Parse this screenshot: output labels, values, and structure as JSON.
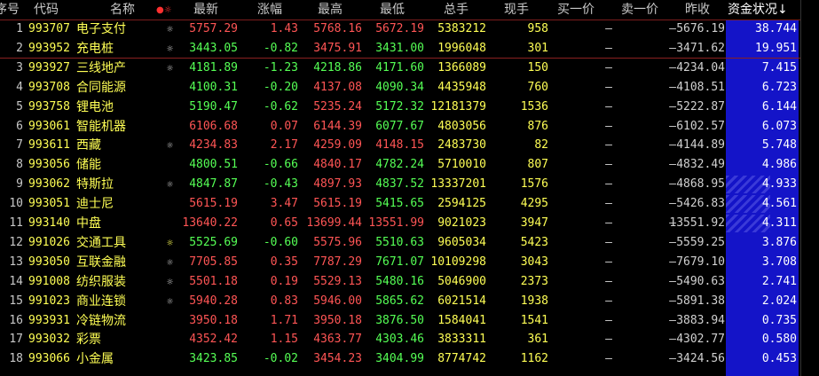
{
  "header": {
    "index": "序号",
    "code": "代码",
    "name": "名称",
    "flags": "●☼",
    "last": "最新",
    "change_pct": "涨幅",
    "high": "最高",
    "low": "最低",
    "total_vol": "总手",
    "cur_vol": "现手",
    "bid": "买一价",
    "ask": "卖一价",
    "prev_close": "昨收",
    "fund": "资金状况↓"
  },
  "colors": {
    "up": "#ff5555",
    "down": "#55ff55",
    "flat": "#d0d0d0",
    "code": "#ffff55",
    "sort_column": "#1414c8"
  },
  "rows": [
    {
      "i": "1",
      "code": "993707",
      "name": "电子支付",
      "gear": "gear-icon",
      "last": "5757.29",
      "chg": "1.43",
      "high": "5768.16",
      "low": "5672.19",
      "vol": "5383212",
      "cur": "958",
      "bid": "—",
      "ask": "—",
      "prev": "5676.19",
      "fund": "38.744",
      "dir": "up",
      "hcol": "red",
      "lcol": "red",
      "hatch": false
    },
    {
      "i": "2",
      "code": "993952",
      "name": "充电桩",
      "gear": "gear-icon",
      "last": "3443.05",
      "chg": "-0.82",
      "high": "3475.91",
      "low": "3431.00",
      "vol": "1996048",
      "cur": "301",
      "bid": "—",
      "ask": "—",
      "prev": "3471.62",
      "fund": "19.951",
      "dir": "down",
      "hcol": "red",
      "lcol": "green",
      "hatch": false
    },
    {
      "i": "3",
      "code": "993927",
      "name": "三线地产",
      "gear": "gear-icon",
      "last": "4181.89",
      "chg": "-1.23",
      "high": "4218.86",
      "low": "4171.60",
      "vol": "1366089",
      "cur": "150",
      "bid": "—",
      "ask": "—",
      "prev": "4234.04",
      "fund": "7.415",
      "dir": "down",
      "hcol": "green",
      "lcol": "green",
      "hatch": false
    },
    {
      "i": "4",
      "code": "993708",
      "name": "合同能源",
      "gear": "",
      "last": "4100.31",
      "chg": "-0.20",
      "high": "4137.08",
      "low": "4090.34",
      "vol": "4435948",
      "cur": "760",
      "bid": "—",
      "ask": "—",
      "prev": "4108.51",
      "fund": "6.723",
      "dir": "down",
      "hcol": "red",
      "lcol": "green",
      "hatch": false
    },
    {
      "i": "5",
      "code": "993758",
      "name": "锂电池",
      "gear": "",
      "last": "5190.47",
      "chg": "-0.62",
      "high": "5235.24",
      "low": "5172.32",
      "vol": "12181379",
      "cur": "1536",
      "bid": "—",
      "ask": "—",
      "prev": "5222.87",
      "fund": "6.144",
      "dir": "down",
      "hcol": "red",
      "lcol": "green",
      "hatch": false
    },
    {
      "i": "6",
      "code": "993061",
      "name": "智能机器",
      "gear": "",
      "last": "6106.68",
      "chg": "0.07",
      "high": "6144.39",
      "low": "6077.67",
      "vol": "4803056",
      "cur": "876",
      "bid": "—",
      "ask": "—",
      "prev": "6102.57",
      "fund": "6.073",
      "dir": "up",
      "hcol": "red",
      "lcol": "green",
      "hatch": false
    },
    {
      "i": "7",
      "code": "993611",
      "name": "西藏",
      "gear": "gear-icon",
      "last": "4234.83",
      "chg": "2.17",
      "high": "4259.09",
      "low": "4148.15",
      "vol": "2483730",
      "cur": "82",
      "bid": "—",
      "ask": "—",
      "prev": "4144.89",
      "fund": "5.748",
      "dir": "up",
      "hcol": "red",
      "lcol": "red",
      "hatch": false
    },
    {
      "i": "8",
      "code": "993056",
      "name": "储能",
      "gear": "",
      "last": "4800.51",
      "chg": "-0.66",
      "high": "4840.17",
      "low": "4782.24",
      "vol": "5710010",
      "cur": "807",
      "bid": "—",
      "ask": "—",
      "prev": "4832.49",
      "fund": "4.986",
      "dir": "down",
      "hcol": "red",
      "lcol": "green",
      "hatch": false
    },
    {
      "i": "9",
      "code": "993062",
      "name": "特斯拉",
      "gear": "gear-icon",
      "last": "4847.87",
      "chg": "-0.43",
      "high": "4897.93",
      "low": "4837.52",
      "vol": "13337201",
      "cur": "1576",
      "bid": "—",
      "ask": "—",
      "prev": "4868.95",
      "fund": "4.933",
      "dir": "down",
      "hcol": "red",
      "lcol": "green",
      "hatch": true
    },
    {
      "i": "10",
      "code": "993051",
      "name": "迪士尼",
      "gear": "",
      "last": "5615.19",
      "chg": "3.47",
      "high": "5615.19",
      "low": "5415.65",
      "vol": "2594125",
      "cur": "4295",
      "bid": "—",
      "ask": "—",
      "prev": "5426.83",
      "fund": "4.561",
      "dir": "up",
      "hcol": "red",
      "lcol": "green",
      "hatch": true
    },
    {
      "i": "11",
      "code": "993140",
      "name": "中盘",
      "gear": "",
      "last": "13640.22",
      "chg": "0.65",
      "high": "13699.44",
      "low": "13551.99",
      "vol": "9021023",
      "cur": "3947",
      "bid": "—",
      "ask": "—",
      "prev": "13551.92",
      "fund": "4.311",
      "dir": "up",
      "hcol": "red",
      "lcol": "red",
      "hatch": true
    },
    {
      "i": "12",
      "code": "991026",
      "name": "交通工具",
      "gear": "gearY",
      "last": "5525.69",
      "chg": "-0.60",
      "high": "5575.96",
      "low": "5510.63",
      "vol": "9605034",
      "cur": "5423",
      "bid": "—",
      "ask": "—",
      "prev": "5559.25",
      "fund": "3.876",
      "dir": "down",
      "hcol": "red",
      "lcol": "green",
      "hatch": false
    },
    {
      "i": "13",
      "code": "993050",
      "name": "互联金融",
      "gear": "gear-icon",
      "last": "7705.85",
      "chg": "0.35",
      "high": "7787.29",
      "low": "7671.07",
      "vol": "10109298",
      "cur": "3043",
      "bid": "—",
      "ask": "—",
      "prev": "7679.10",
      "fund": "3.708",
      "dir": "up",
      "hcol": "red",
      "lcol": "green",
      "hatch": false
    },
    {
      "i": "14",
      "code": "991008",
      "name": "纺织服装",
      "gear": "gear-icon",
      "last": "5501.18",
      "chg": "0.19",
      "high": "5529.13",
      "low": "5480.16",
      "vol": "5046900",
      "cur": "2373",
      "bid": "—",
      "ask": "—",
      "prev": "5490.63",
      "fund": "2.741",
      "dir": "up",
      "hcol": "red",
      "lcol": "green",
      "hatch": false
    },
    {
      "i": "15",
      "code": "991023",
      "name": "商业连锁",
      "gear": "gear-icon",
      "last": "5940.28",
      "chg": "0.83",
      "high": "5946.00",
      "low": "5865.62",
      "vol": "6021514",
      "cur": "1938",
      "bid": "—",
      "ask": "—",
      "prev": "5891.38",
      "fund": "2.024",
      "dir": "up",
      "hcol": "red",
      "lcol": "green",
      "hatch": false
    },
    {
      "i": "16",
      "code": "993931",
      "name": "冷链物流",
      "gear": "",
      "last": "3950.18",
      "chg": "1.71",
      "high": "3950.18",
      "low": "3876.50",
      "vol": "1584041",
      "cur": "1541",
      "bid": "—",
      "ask": "—",
      "prev": "3883.94",
      "fund": "0.735",
      "dir": "up",
      "hcol": "red",
      "lcol": "green",
      "hatch": false
    },
    {
      "i": "17",
      "code": "993032",
      "name": "彩票",
      "gear": "",
      "last": "4352.42",
      "chg": "1.15",
      "high": "4363.77",
      "low": "4303.46",
      "vol": "3833311",
      "cur": "361",
      "bid": "—",
      "ask": "—",
      "prev": "4302.77",
      "fund": "0.580",
      "dir": "up",
      "hcol": "red",
      "lcol": "green",
      "hatch": false
    },
    {
      "i": "18",
      "code": "993066",
      "name": "小金属",
      "gear": "",
      "last": "3423.85",
      "chg": "-0.02",
      "high": "3454.23",
      "low": "3404.99",
      "vol": "8774742",
      "cur": "1162",
      "bid": "—",
      "ask": "—",
      "prev": "3424.56",
      "fund": "0.453",
      "dir": "down",
      "hcol": "red",
      "lcol": "green",
      "hatch": false
    }
  ]
}
